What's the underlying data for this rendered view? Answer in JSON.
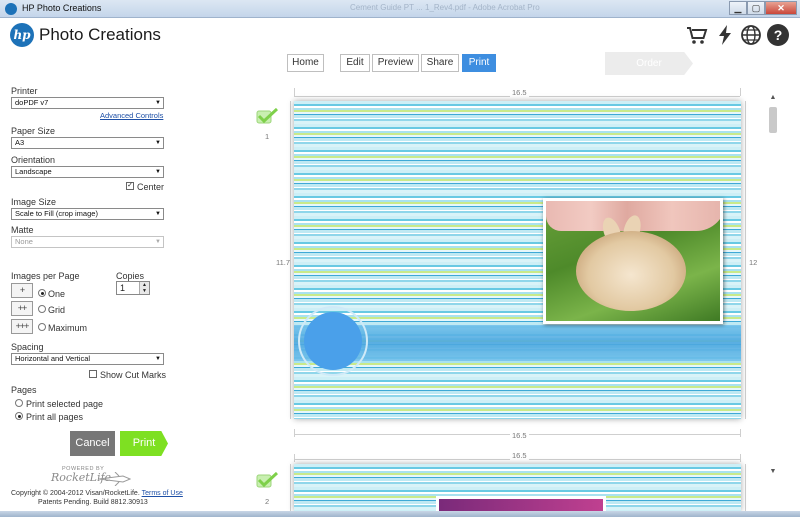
{
  "window": {
    "title": "HP Photo Creations",
    "ghost_title": "Cement Guide PT ... 1_Rev4.pdf - Adobe Acrobat Pro",
    "min": "▁",
    "max": "▢",
    "close": "✕"
  },
  "header": {
    "logo_text": "hp",
    "app_name": "Photo Creations",
    "icons": [
      "shopping-cart-icon",
      "lightning-icon",
      "globe-icon",
      "help-icon"
    ],
    "help_glyph": "?"
  },
  "nav": {
    "home": "Home",
    "edit": "Edit",
    "preview": "Preview",
    "share": "Share",
    "print": "Print",
    "order": "Order",
    "active": "Print"
  },
  "sidebar": {
    "printer_label": "Printer",
    "printer_value": "doPDF v7",
    "advanced_controls": "Advanced Controls",
    "paper_size_label": "Paper Size",
    "paper_size_value": "A3",
    "orientation_label": "Orientation",
    "orientation_value": "Landscape",
    "center_label": "Center",
    "center_checked": true,
    "image_size_label": "Image Size",
    "image_size_value": "Scale to Fill (crop image)",
    "matte_label": "Matte",
    "matte_value": "None",
    "images_per_page_label": "Images per Page",
    "ipp_options": [
      "One",
      "Grid",
      "Maximum"
    ],
    "ipp_selected": "One",
    "copies_label": "Copies",
    "copies_value": "1",
    "spacing_label": "Spacing",
    "spacing_value": "Horizontal and Vertical",
    "show_cut_marks_label": "Show Cut Marks",
    "show_cut_marks_checked": false,
    "pages_label": "Pages",
    "print_selected_page": "Print selected page",
    "print_all_pages": "Print all pages",
    "pages_selected": "Print all pages",
    "cancel": "Cancel",
    "print": "Print",
    "powered_by": "POWERED BY",
    "rocketlife": "RocketLife",
    "copyright": "Copyright © 2004-2012 Visan/RocketLife.",
    "terms": "Terms of Use",
    "patents": "Patents Pending. Build 8812.30913"
  },
  "preview": {
    "page1": {
      "number": "1",
      "width_label": "16.5",
      "height_left": "11.7",
      "height_right": "12",
      "bottom_width_label": "16.5"
    },
    "page2": {
      "number": "2",
      "width_label": "16.5"
    }
  },
  "colors": {
    "accent_blue": "#3e8ee0",
    "print_green": "#7ee022",
    "cancel_gray": "#777777",
    "hp_blue": "#1d72b8"
  }
}
